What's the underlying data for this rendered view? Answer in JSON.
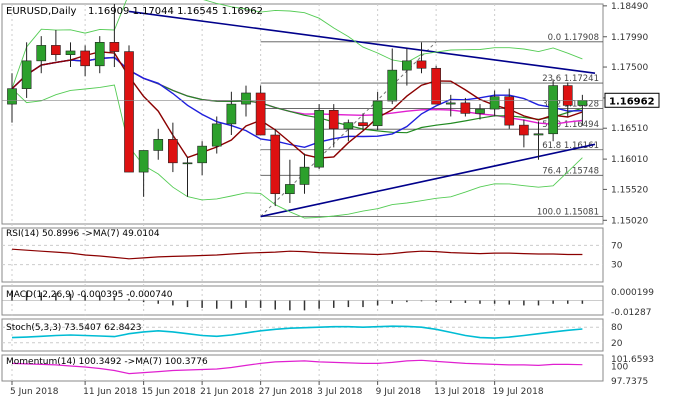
{
  "header": {
    "symbol": "EURUSD,Daily",
    "ohlc": "1.16909 1.17044 1.16545 1.16962"
  },
  "colors": {
    "bull": "#2ca02c",
    "bear": "#dd1111",
    "ma_red": "#8b0000",
    "ma_blue": "#1f1fdd",
    "ma_green": "#228b22",
    "ma_magenta": "#e020d0",
    "band": "#55cc55",
    "trend": "#00008b",
    "fib": "#555555",
    "cyan": "#00bcd4",
    "grid": "#cccccc",
    "axis_text": "#333333"
  },
  "chart_data": [
    {
      "type": "candlestick",
      "panel": "price",
      "y_axis_ticks": [
        "1.18490",
        "1.17990",
        "1.17500",
        "1.17000",
        "1.16510",
        "1.16010",
        "1.15520",
        "1.15020"
      ],
      "ylim": [
        1.1496,
        1.1852
      ],
      "current_price": "1.16962",
      "x_ticks": [
        "5 Jun 2018",
        "11 Jun 2018",
        "15 Jun 2018",
        "21 Jun 2018",
        "27 Jun 2018",
        "3 Jul 2018",
        "9 Jul 2018",
        "13 Jul 2018",
        "19 Jul 2018"
      ],
      "candles": [
        {
          "o": 1.169,
          "h": 1.174,
          "l": 1.166,
          "c": 1.1715
        },
        {
          "o": 1.1715,
          "h": 1.179,
          "l": 1.17,
          "c": 1.176
        },
        {
          "o": 1.176,
          "h": 1.18,
          "l": 1.174,
          "c": 1.1785
        },
        {
          "o": 1.1785,
          "h": 1.181,
          "l": 1.176,
          "c": 1.177
        },
        {
          "o": 1.177,
          "h": 1.179,
          "l": 1.175,
          "c": 1.1776
        },
        {
          "o": 1.1776,
          "h": 1.1785,
          "l": 1.1735,
          "c": 1.1752
        },
        {
          "o": 1.1752,
          "h": 1.18,
          "l": 1.174,
          "c": 1.179
        },
        {
          "o": 1.179,
          "h": 1.1852,
          "l": 1.175,
          "c": 1.1775
        },
        {
          "o": 1.1775,
          "h": 1.1785,
          "l": 1.158,
          "c": 1.158
        },
        {
          "o": 1.158,
          "h": 1.1615,
          "l": 1.154,
          "c": 1.1615
        },
        {
          "o": 1.1615,
          "h": 1.165,
          "l": 1.16,
          "c": 1.1633
        },
        {
          "o": 1.1633,
          "h": 1.166,
          "l": 1.158,
          "c": 1.1595
        },
        {
          "o": 1.1595,
          "h": 1.1605,
          "l": 1.154,
          "c": 1.1595
        },
        {
          "o": 1.1595,
          "h": 1.163,
          "l": 1.1575,
          "c": 1.1622
        },
        {
          "o": 1.1622,
          "h": 1.167,
          "l": 1.161,
          "c": 1.1658
        },
        {
          "o": 1.1658,
          "h": 1.171,
          "l": 1.164,
          "c": 1.169
        },
        {
          "o": 1.169,
          "h": 1.172,
          "l": 1.167,
          "c": 1.1708
        },
        {
          "o": 1.1708,
          "h": 1.172,
          "l": 1.164,
          "c": 1.164
        },
        {
          "o": 1.164,
          "h": 1.165,
          "l": 1.1525,
          "c": 1.1545
        },
        {
          "o": 1.1545,
          "h": 1.16,
          "l": 1.153,
          "c": 1.156
        },
        {
          "o": 1.156,
          "h": 1.161,
          "l": 1.1545,
          "c": 1.1588
        },
        {
          "o": 1.1588,
          "h": 1.169,
          "l": 1.1585,
          "c": 1.168
        },
        {
          "o": 1.168,
          "h": 1.169,
          "l": 1.162,
          "c": 1.165
        },
        {
          "o": 1.165,
          "h": 1.1665,
          "l": 1.163,
          "c": 1.166
        },
        {
          "o": 1.166,
          "h": 1.1675,
          "l": 1.1648,
          "c": 1.1655
        },
        {
          "o": 1.1655,
          "h": 1.171,
          "l": 1.1648,
          "c": 1.1695
        },
        {
          "o": 1.1695,
          "h": 1.178,
          "l": 1.169,
          "c": 1.1745
        },
        {
          "o": 1.1745,
          "h": 1.178,
          "l": 1.172,
          "c": 1.176
        },
        {
          "o": 1.176,
          "h": 1.179,
          "l": 1.174,
          "c": 1.1748
        },
        {
          "o": 1.1748,
          "h": 1.1752,
          "l": 1.169,
          "c": 1.169
        },
        {
          "o": 1.169,
          "h": 1.1705,
          "l": 1.167,
          "c": 1.1692
        },
        {
          "o": 1.1692,
          "h": 1.17,
          "l": 1.167,
          "c": 1.1675
        },
        {
          "o": 1.1675,
          "h": 1.169,
          "l": 1.1665,
          "c": 1.1682
        },
        {
          "o": 1.1682,
          "h": 1.1712,
          "l": 1.167,
          "c": 1.1702
        },
        {
          "o": 1.1702,
          "h": 1.1715,
          "l": 1.165,
          "c": 1.1656
        },
        {
          "o": 1.1656,
          "h": 1.1665,
          "l": 1.162,
          "c": 1.164
        },
        {
          "o": 1.164,
          "h": 1.1662,
          "l": 1.16,
          "c": 1.1642
        },
        {
          "o": 1.1642,
          "h": 1.173,
          "l": 1.163,
          "c": 1.172
        },
        {
          "o": 1.172,
          "h": 1.1725,
          "l": 1.167,
          "c": 1.1688
        },
        {
          "o": 1.1688,
          "h": 1.1705,
          "l": 1.1655,
          "c": 1.1696
        }
      ]
    },
    {
      "type": "line",
      "panel": "rsi",
      "label": "RSI(14) 50.8996 ->MA(7) 49.0104",
      "y_axis_ticks": [
        "70",
        "30"
      ],
      "ylim": [
        0,
        100
      ],
      "series": [
        {
          "values": [
            62,
            60,
            58,
            56,
            54,
            50,
            48,
            45,
            42,
            44,
            46,
            47,
            48,
            49,
            50,
            52,
            54,
            55,
            56,
            58,
            57,
            55,
            54,
            53,
            52,
            51,
            53,
            56,
            58,
            57,
            55,
            54,
            53,
            54,
            54,
            53,
            52,
            52,
            51,
            51
          ]
        }
      ]
    },
    {
      "type": "bar",
      "panel": "macd",
      "label": "MACD(12,26,9) -0.000395 -0.000740",
      "y_axis_ticks": [
        "0.000199",
        "-0.01287"
      ],
      "series": [
        {
          "values": [
            0.0012,
            0.0011,
            0.001,
            0.0009,
            0.0008,
            0.0007,
            0.0006,
            0.0004,
            0.0002,
            -0.0002,
            -0.0004,
            -0.0006,
            -0.0008,
            -0.0009,
            -0.001,
            -0.001,
            -0.0009,
            -0.0009,
            -0.0011,
            -0.0012,
            -0.0012,
            -0.001,
            -0.0009,
            -0.0008,
            -0.0008,
            -0.0006,
            -0.0004,
            -0.0002,
            -0.0001,
            -0.0002,
            -0.0003,
            -0.0003,
            -0.0004,
            -0.0004,
            -0.0005,
            -0.0006,
            -0.0006,
            -0.0004,
            -0.0004,
            -0.0004
          ]
        }
      ]
    },
    {
      "type": "line",
      "panel": "stoch",
      "label": "Stoch(5,3,3) 73.5407 62.8423",
      "y_axis_ticks": [
        "80",
        "20"
      ],
      "ylim": [
        0,
        100
      ],
      "series": [
        {
          "values": [
            40,
            42,
            45,
            48,
            50,
            48,
            46,
            44,
            55,
            62,
            66,
            62,
            55,
            48,
            45,
            50,
            58,
            66,
            72,
            76,
            78,
            80,
            82,
            82,
            80,
            82,
            84,
            83,
            80,
            72,
            60,
            48,
            40,
            38,
            42,
            48,
            55,
            62,
            68,
            73
          ]
        }
      ]
    },
    {
      "type": "line",
      "panel": "momentum",
      "label": "Momentum(14) 100.3492 ->MA(7) 100.3776",
      "y_axis_ticks": [
        "101.6593",
        "100",
        "97.7375"
      ],
      "series": [
        {
          "values": [
            100.6,
            100.5,
            100.4,
            100.3,
            100.1,
            99.9,
            99.6,
            99.2,
            98.6,
            98.8,
            99.0,
            99.2,
            99.3,
            99.4,
            99.5,
            99.8,
            100.2,
            100.6,
            100.9,
            101.0,
            101.1,
            100.9,
            100.8,
            100.7,
            100.6,
            100.6,
            100.8,
            101.1,
            101.2,
            101.0,
            100.8,
            100.6,
            100.5,
            100.4,
            100.3,
            100.3,
            100.2,
            100.4,
            100.4,
            100.35
          ]
        }
      ]
    }
  ],
  "fib_levels": [
    {
      "label": "0.0 1.17908",
      "value": 1.17908
    },
    {
      "label": "23.6 1.17241",
      "value": 1.17241
    },
    {
      "label": "38.2 1.16828",
      "value": 1.16828
    },
    {
      "label": "50.0 1.16494",
      "value": 1.16494
    },
    {
      "label": "61.8 1.16161",
      "value": 1.16161
    },
    {
      "label": "76.4 1.15748",
      "value": 1.15748
    },
    {
      "label": "100.0 1.15081",
      "value": 1.15081
    }
  ]
}
